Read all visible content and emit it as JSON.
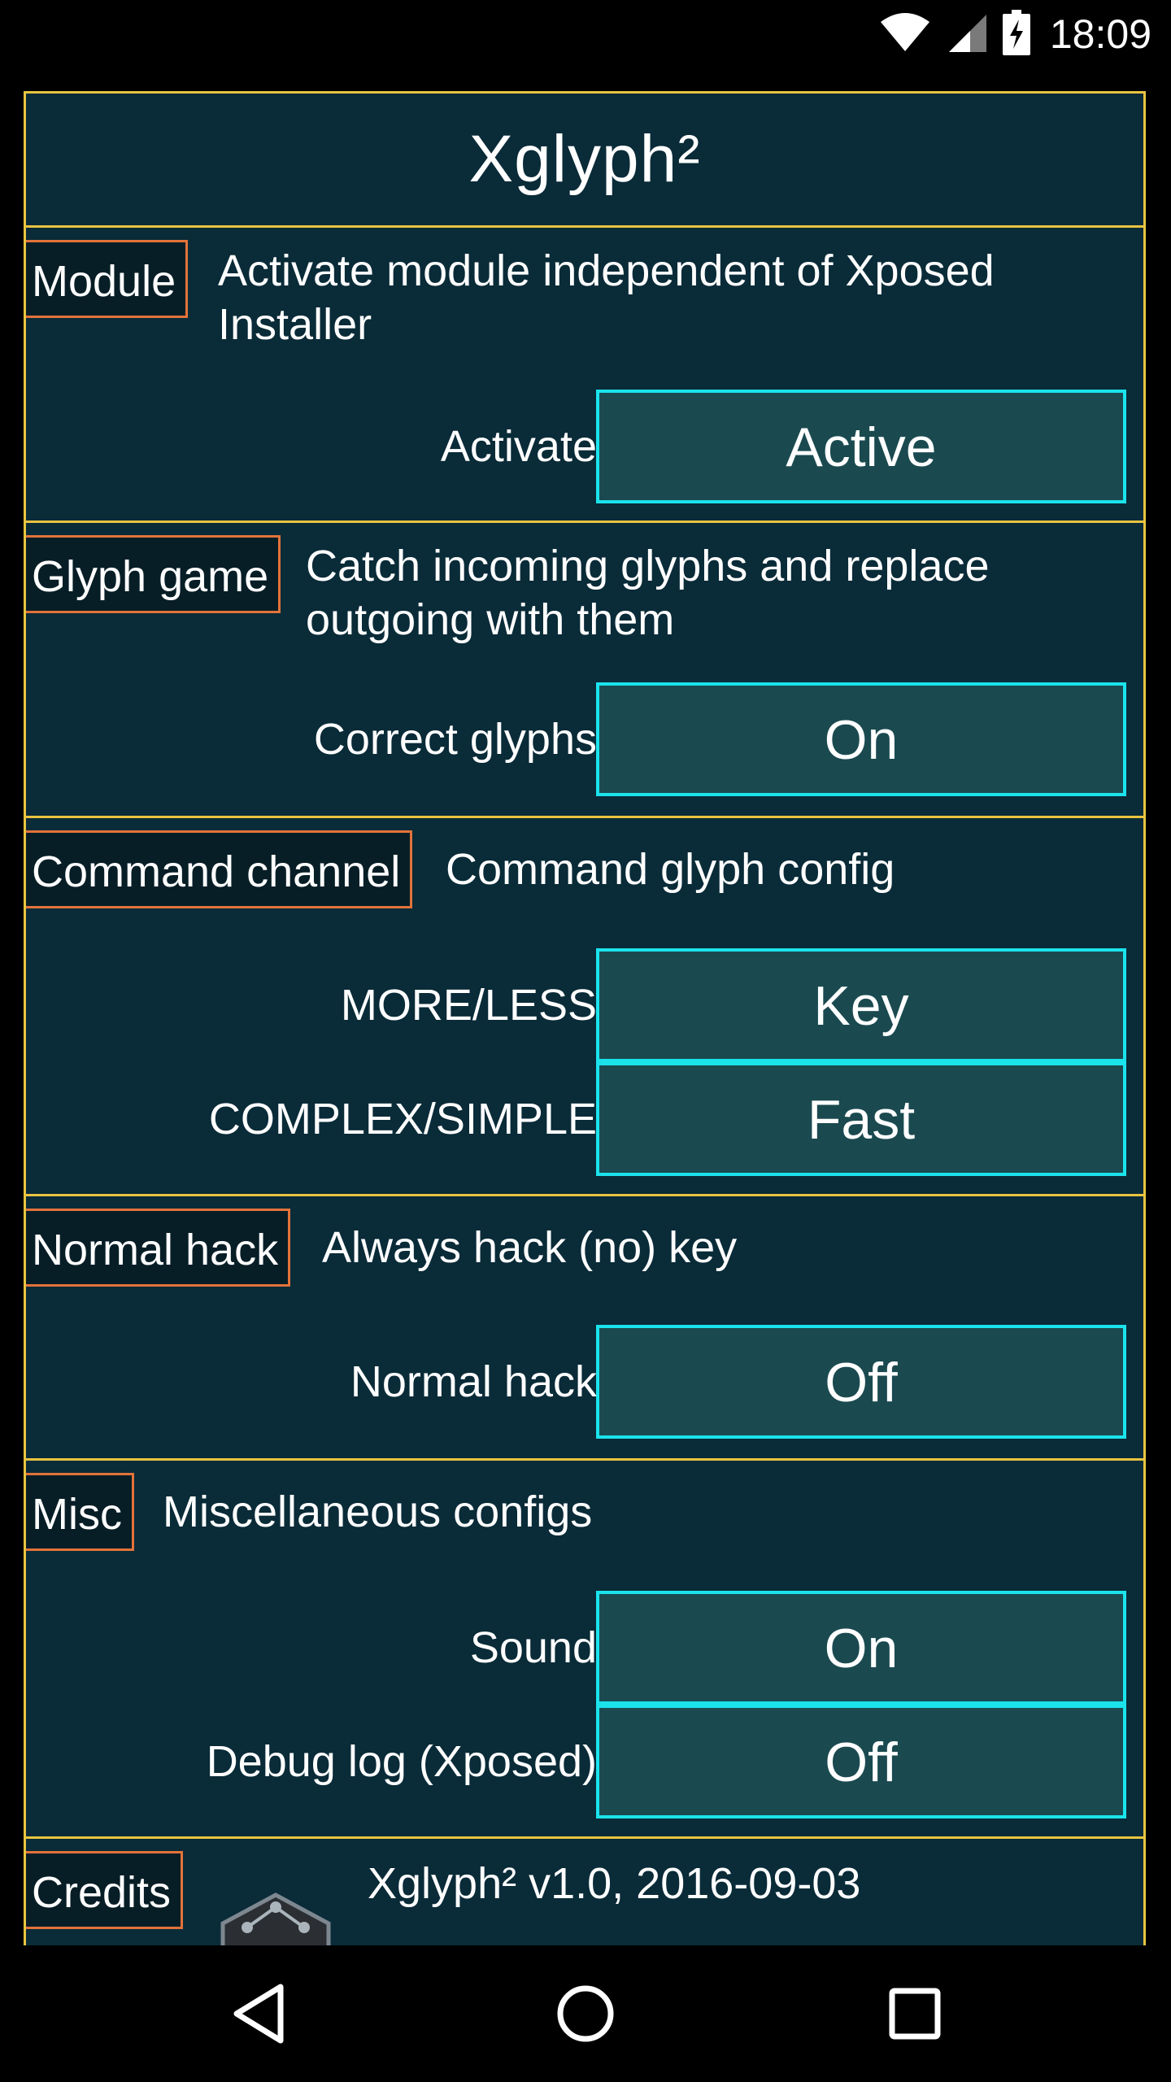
{
  "status_bar": {
    "time": "18:09"
  },
  "app": {
    "title": "Xglyph²"
  },
  "sections": {
    "module": {
      "tag": "Module",
      "description_line1": "Activate module independent of Xposed",
      "description_line2": "Installer",
      "settings": [
        {
          "label": "Activate",
          "value": "Active"
        }
      ]
    },
    "glyph_game": {
      "tag": "Glyph game",
      "description_line1": "Catch incoming glyphs and replace",
      "description_line2": "outgoing with them",
      "settings": [
        {
          "label": "Correct glyphs",
          "value": "On"
        }
      ]
    },
    "command_channel": {
      "tag": "Command channel",
      "description_line1": "Command glyph config",
      "settings": [
        {
          "label": "MORE/LESS",
          "value": "Key"
        },
        {
          "label": "COMPLEX/SIMPLE",
          "value": "Fast"
        }
      ]
    },
    "normal_hack": {
      "tag": "Normal hack",
      "description_line1": "Always hack (no) key",
      "settings": [
        {
          "label": "Normal hack",
          "value": "Off"
        }
      ]
    },
    "misc": {
      "tag": "Misc",
      "description_line1": "Miscellaneous configs",
      "settings": [
        {
          "label": "Sound",
          "value": "On"
        },
        {
          "label": "Debug log (Xposed)",
          "value": "Off"
        }
      ]
    },
    "credits": {
      "tag": "Credits",
      "description_line1": "Xglyph² v1.0, 2016-09-03"
    }
  },
  "colors": {
    "panel_bg": "#0a2b38",
    "frame_border": "#e9c440",
    "tag_border": "#e2733a",
    "button_border": "#1be3ec",
    "button_bg": "#1a4a50"
  },
  "icons": {
    "wifi": "wifi-icon",
    "signal": "cell-signal-icon",
    "battery": "battery-charging-icon",
    "back": "back-icon",
    "home": "home-icon",
    "recents": "recents-icon"
  }
}
